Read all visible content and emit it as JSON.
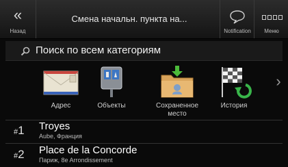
{
  "header": {
    "back_label": "Назад",
    "title": "Смена начальн. пункта на...",
    "notification_label": "Notification",
    "menu_label": "Меню"
  },
  "search": {
    "text": "Поиск по всем категориям"
  },
  "categories": [
    {
      "label": "Адрес",
      "icon": "envelope-icon"
    },
    {
      "label": "Объекты",
      "icon": "poi-icon"
    },
    {
      "label": "Сохраненное место",
      "icon": "saved-folder-icon"
    },
    {
      "label": "История",
      "icon": "history-flag-icon"
    }
  ],
  "recent": [
    {
      "index": "1",
      "name": "Troyes",
      "sub": "Aube, Франция"
    },
    {
      "index": "2",
      "name": "Place de la Concorde",
      "sub": "Париж, 8e Arrondissement"
    }
  ],
  "colors": {
    "background": "#0a0a0a",
    "header": "#2c2c2c",
    "text": "#ffffff"
  }
}
